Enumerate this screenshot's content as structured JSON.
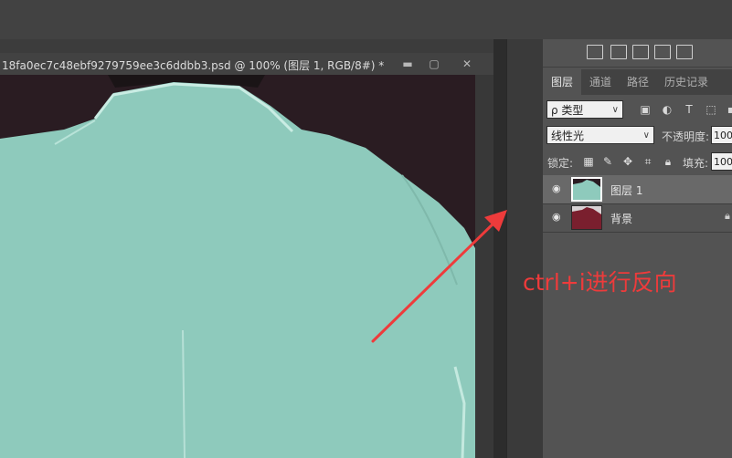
{
  "document": {
    "title": "18fa0ec7c48ebf9279759ee3c6ddbb3.psd @ 100% (图层 1, RGB/8#) *",
    "minimize_label": "▬",
    "maximize_label": "▢",
    "close_label": "✕"
  },
  "panel_tabs": [
    {
      "label": "图层",
      "active": true
    },
    {
      "label": "通道",
      "active": false
    },
    {
      "label": "路径",
      "active": false
    },
    {
      "label": "历史记录",
      "active": false
    }
  ],
  "filter": {
    "kind_label": "ρ 类型"
  },
  "blend": {
    "mode": "线性光",
    "opacity_label": "不透明度:",
    "opacity_value": "100"
  },
  "lock": {
    "label": "锁定:",
    "fill_label": "填充:",
    "fill_value": "100"
  },
  "layers": [
    {
      "name": "图层 1",
      "selected": true,
      "visible": true
    },
    {
      "name": "背景",
      "selected": false,
      "visible": true,
      "locked": true
    }
  ],
  "annotation": {
    "text": "ctrl+i进行反向",
    "color": "#ee3b3b"
  },
  "colors": {
    "canvas_fabric": "#8ecabc",
    "canvas_dark": "#2a1c22",
    "thumb_bg": "#7a1f2e"
  }
}
